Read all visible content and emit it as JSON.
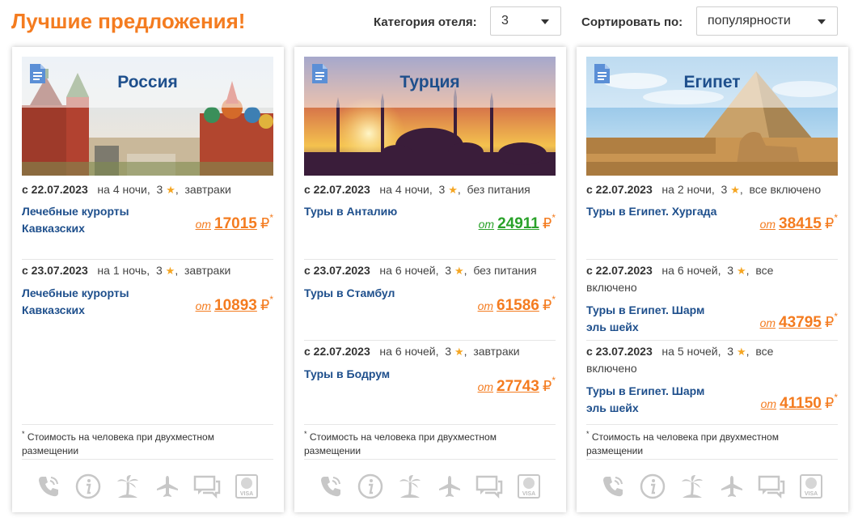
{
  "header": {
    "title": "Лучшие предложения!",
    "category_label": "Категория отеля:",
    "category_value": "3",
    "sort_label": "Сортировать по:",
    "sort_value": "популярности"
  },
  "common": {
    "price_prefix": "от",
    "currency": "₽",
    "asterisk": "*",
    "star_glyph": "★",
    "footnote": "Стоимость на человека при двухместном размещении"
  },
  "colors": {
    "accent": "#f47c20",
    "link": "#1e4f8c",
    "green_price": "#2aa22a",
    "star": "#f5a623"
  },
  "cards": [
    {
      "country": "Россия",
      "offers": [
        {
          "date": "с 22.07.2023",
          "nights": "на 4 ночи,",
          "stars": "3",
          "meal": "завтраки",
          "tour": "Лечебные курорты Кавказских",
          "price": "17015"
        },
        {
          "date": "с 23.07.2023",
          "nights": "на 1 ночь,",
          "stars": "3",
          "meal": "завтраки",
          "tour": "Лечебные курорты Кавказских",
          "price": "10893"
        }
      ]
    },
    {
      "country": "Турция",
      "offers": [
        {
          "date": "с 22.07.2023",
          "nights": "на 4 ночи,",
          "stars": "3",
          "meal": "без питания",
          "tour": "Туры в Анталию",
          "price": "24911"
        },
        {
          "date": "с 23.07.2023",
          "nights": "на 6 ночей,",
          "stars": "3",
          "meal": "без питания",
          "tour": "Туры в Стамбул",
          "price": "61586"
        },
        {
          "date": "с 22.07.2023",
          "nights": "на 6 ночей,",
          "stars": "3",
          "meal": "завтраки",
          "tour": "Туры в Бодрум",
          "price": "27743"
        }
      ]
    },
    {
      "country": "Египет",
      "offers": [
        {
          "date": "с 22.07.2023",
          "nights": "на 2 ночи,",
          "stars": "3",
          "meal": "все включено",
          "tour": "Туры в Египет. Хургада",
          "price": "38415"
        },
        {
          "date": "с 22.07.2023",
          "nights": "на 6 ночей,",
          "stars": "3",
          "meal": "все включено",
          "tour": "Туры в Египет. Шарм эль шейх",
          "price": "43795"
        },
        {
          "date": "с 23.07.2023",
          "nights": "на 5 ночей,",
          "stars": "3",
          "meal": "все включено",
          "tour": "Туры в Египет. Шарм эль шейх",
          "price": "41150"
        }
      ]
    }
  ],
  "footer_icons": [
    "phone-icon",
    "info-icon",
    "palm-beach-icon",
    "airplane-icon",
    "chat-icon",
    "visa-card-icon"
  ],
  "visa_text": "VISA"
}
